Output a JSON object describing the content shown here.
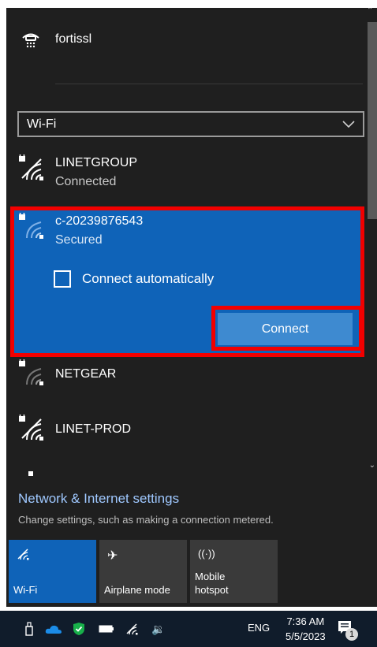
{
  "vpn": {
    "name": "fortissl",
    "icon": "vpn-icon"
  },
  "adapter_select": {
    "value": "Wi-Fi",
    "icon": "chevron-down-icon"
  },
  "networks": [
    {
      "name": "LINETGROUP",
      "status": "Connected",
      "icon": "wifi-secured-icon"
    },
    {
      "name": "c-20239876543",
      "status": "Secured",
      "icon": "wifi-secured-icon",
      "selected": true
    },
    {
      "name": "NETGEAR",
      "status": "",
      "icon": "wifi-secured-icon"
    },
    {
      "name": "LINET-PROD",
      "status": "",
      "icon": "wifi-secured-icon"
    }
  ],
  "selected_network": {
    "connect_automatically_label": "Connect automatically",
    "connect_automatically_checked": false,
    "connect_button_label": "Connect"
  },
  "settings": {
    "link": "Network & Internet settings",
    "description": "Change settings, such as making a connection metered."
  },
  "quick_actions": [
    {
      "label": "Wi-Fi",
      "icon": "wifi-icon",
      "active": true
    },
    {
      "label": "Airplane mode",
      "icon": "airplane-icon",
      "active": false
    },
    {
      "label": "Mobile\nhotspot",
      "icon": "hotspot-icon",
      "active": false
    }
  ],
  "taskbar": {
    "language": "ENG",
    "time": "7:36 AM",
    "date": "5/5/2023",
    "notification_count": "1"
  },
  "colors": {
    "flyout_bg": "#1f1f1f",
    "accent": "#0f63b8",
    "highlight_outline": "#f20000",
    "link": "#9fc8ff"
  }
}
